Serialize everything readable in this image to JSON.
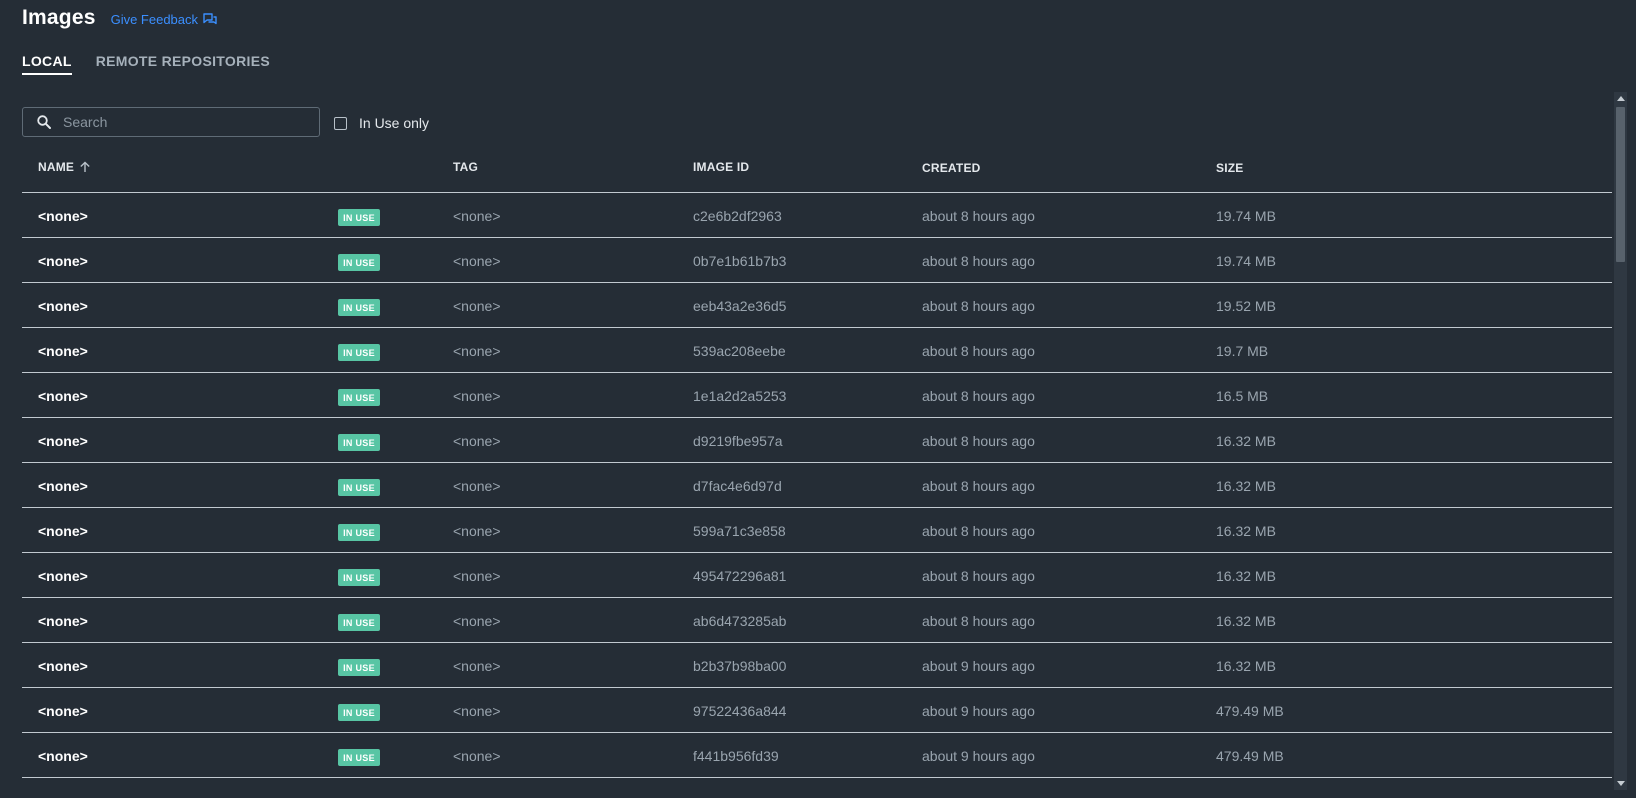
{
  "header": {
    "title": "Images",
    "feedback_label": "Give Feedback",
    "feedback_icon": "chat-bubbles-icon"
  },
  "tabs": [
    {
      "label": "LOCAL",
      "active": true
    },
    {
      "label": "REMOTE REPOSITORIES",
      "active": false
    }
  ],
  "search": {
    "placeholder": "Search",
    "value": ""
  },
  "filter": {
    "label": "In Use only",
    "checked": false
  },
  "columns": {
    "name": "NAME",
    "tag": "TAG",
    "image_id": "IMAGE ID",
    "created": "CREATED",
    "size": "SIZE",
    "sort_icon": "arrow-up-icon"
  },
  "badge_label": "IN USE",
  "rows": [
    {
      "name": "<none>",
      "tag": "<none>",
      "image_id": "c2e6b2df2963",
      "created": "about 8 hours ago",
      "size": "19.74 MB"
    },
    {
      "name": "<none>",
      "tag": "<none>",
      "image_id": "0b7e1b61b7b3",
      "created": "about 8 hours ago",
      "size": "19.74 MB"
    },
    {
      "name": "<none>",
      "tag": "<none>",
      "image_id": "eeb43a2e36d5",
      "created": "about 8 hours ago",
      "size": "19.52 MB"
    },
    {
      "name": "<none>",
      "tag": "<none>",
      "image_id": "539ac208eebe",
      "created": "about 8 hours ago",
      "size": "19.7 MB"
    },
    {
      "name": "<none>",
      "tag": "<none>",
      "image_id": "1e1a2d2a5253",
      "created": "about 8 hours ago",
      "size": "16.5 MB"
    },
    {
      "name": "<none>",
      "tag": "<none>",
      "image_id": "d9219fbe957a",
      "created": "about 8 hours ago",
      "size": "16.32 MB"
    },
    {
      "name": "<none>",
      "tag": "<none>",
      "image_id": "d7fac4e6d97d",
      "created": "about 8 hours ago",
      "size": "16.32 MB"
    },
    {
      "name": "<none>",
      "tag": "<none>",
      "image_id": "599a71c3e858",
      "created": "about 8 hours ago",
      "size": "16.32 MB"
    },
    {
      "name": "<none>",
      "tag": "<none>",
      "image_id": "495472296a81",
      "created": "about 8 hours ago",
      "size": "16.32 MB"
    },
    {
      "name": "<none>",
      "tag": "<none>",
      "image_id": "ab6d473285ab",
      "created": "about 8 hours ago",
      "size": "16.32 MB"
    },
    {
      "name": "<none>",
      "tag": "<none>",
      "image_id": "b2b37b98ba00",
      "created": "about 9 hours ago",
      "size": "16.32 MB"
    },
    {
      "name": "<none>",
      "tag": "<none>",
      "image_id": "97522436a844",
      "created": "about 9 hours ago",
      "size": "479.49 MB"
    },
    {
      "name": "<none>",
      "tag": "<none>",
      "image_id": "f441b956fd39",
      "created": "about 9 hours ago",
      "size": "479.49 MB"
    }
  ],
  "colors": {
    "background": "#252d36",
    "accent_link": "#3b8fff",
    "badge": "#58c5a4"
  }
}
